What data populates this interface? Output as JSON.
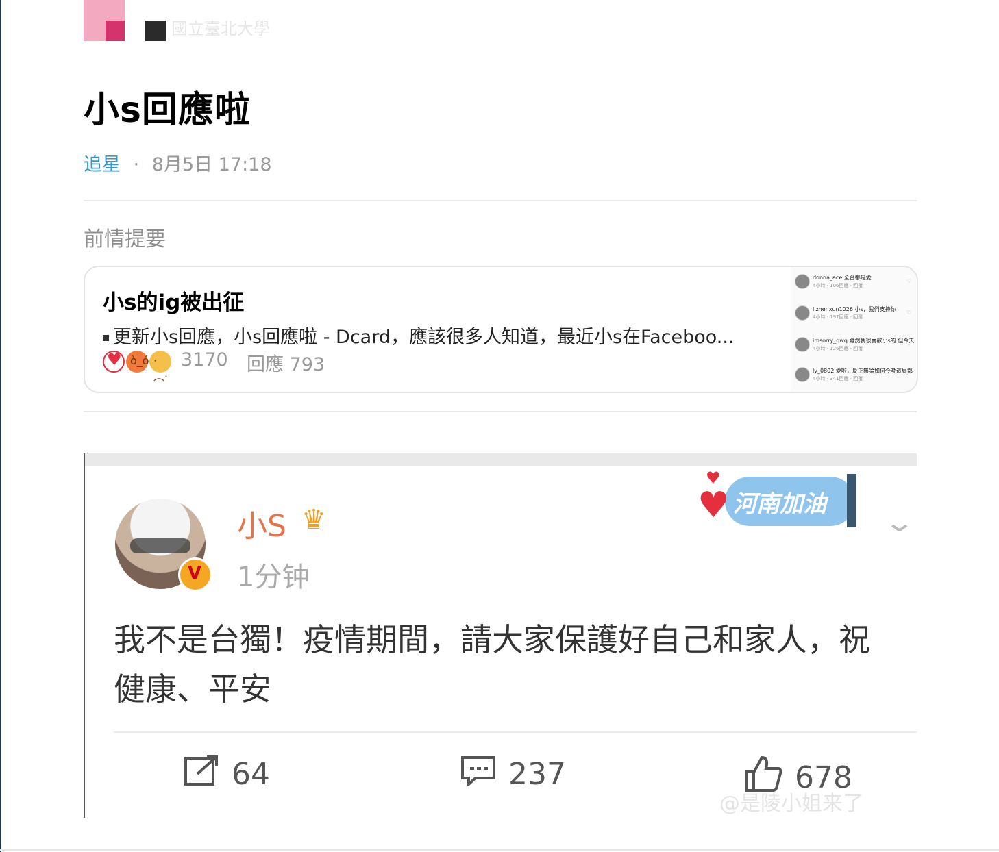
{
  "author": {
    "name": "國立臺北大學"
  },
  "post": {
    "title": "小s回應啦",
    "forum": "追星",
    "separator": "·",
    "timestamp": "8月5日 17:18"
  },
  "section_label": "前情提要",
  "linked_post": {
    "title": "小s的ig被出征",
    "excerpt": "更新小s回應，小s回應啦 - Dcard，應該很多人知道，最近小s在Faceboo...",
    "reactions": [
      "heart",
      "angry",
      "sad"
    ],
    "like_count": "3170",
    "reply_label": "回應 793",
    "thumbnail_comments": [
      {
        "user": "donna_ace 全台都是愛",
        "meta": "4小時 · 106回應 · 回覆"
      },
      {
        "user": "lizhenxun1026 小s，我們支持你",
        "meta": "4小時 · 197回應 · 回覆"
      },
      {
        "user": "imsorry_qwq 雖然我很喜歡小s的 但今天",
        "meta": "4小時 · 126回應 · 回覆"
      },
      {
        "user": "ly_0802 愛啦，反正無論如何今晚這局都",
        "meta": "4小時 · 341回應 · 回覆"
      }
    ]
  },
  "weibo": {
    "name": "小S",
    "time": "1分钟",
    "badge_text": "河南加油",
    "text": "我不是台獨！疫情期間，請大家保護好自己和家人，祝 健康、平安",
    "repost_count": "64",
    "comment_count": "237",
    "like_count": "678",
    "watermark": "@是陵小姐来了"
  },
  "colors": {
    "forum_link": "#3397cf",
    "weibo_name": "#e4754a",
    "heart": "#e62c3f"
  },
  "icons": [
    "share-icon",
    "comment-icon",
    "thumbs-up-icon",
    "crown-icon",
    "chevron-down-icon",
    "verified-v-icon"
  ]
}
